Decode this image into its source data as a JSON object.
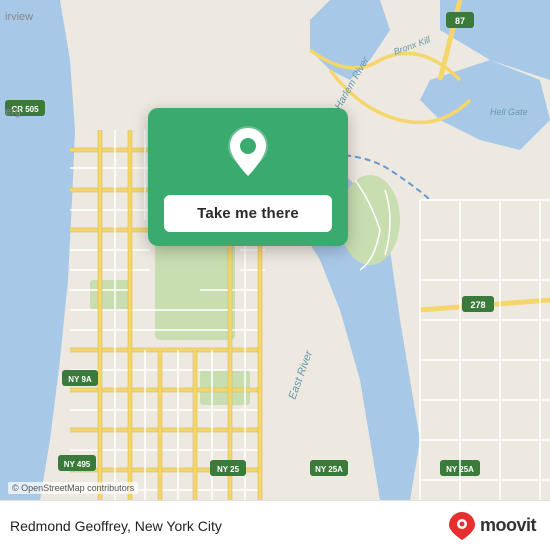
{
  "map": {
    "attribution": "© OpenStreetMap contributors"
  },
  "card": {
    "button_label": "Take me there"
  },
  "bottom_bar": {
    "location_text": "Redmond Geoffrey, New York City",
    "moovit_label": "moovit"
  }
}
